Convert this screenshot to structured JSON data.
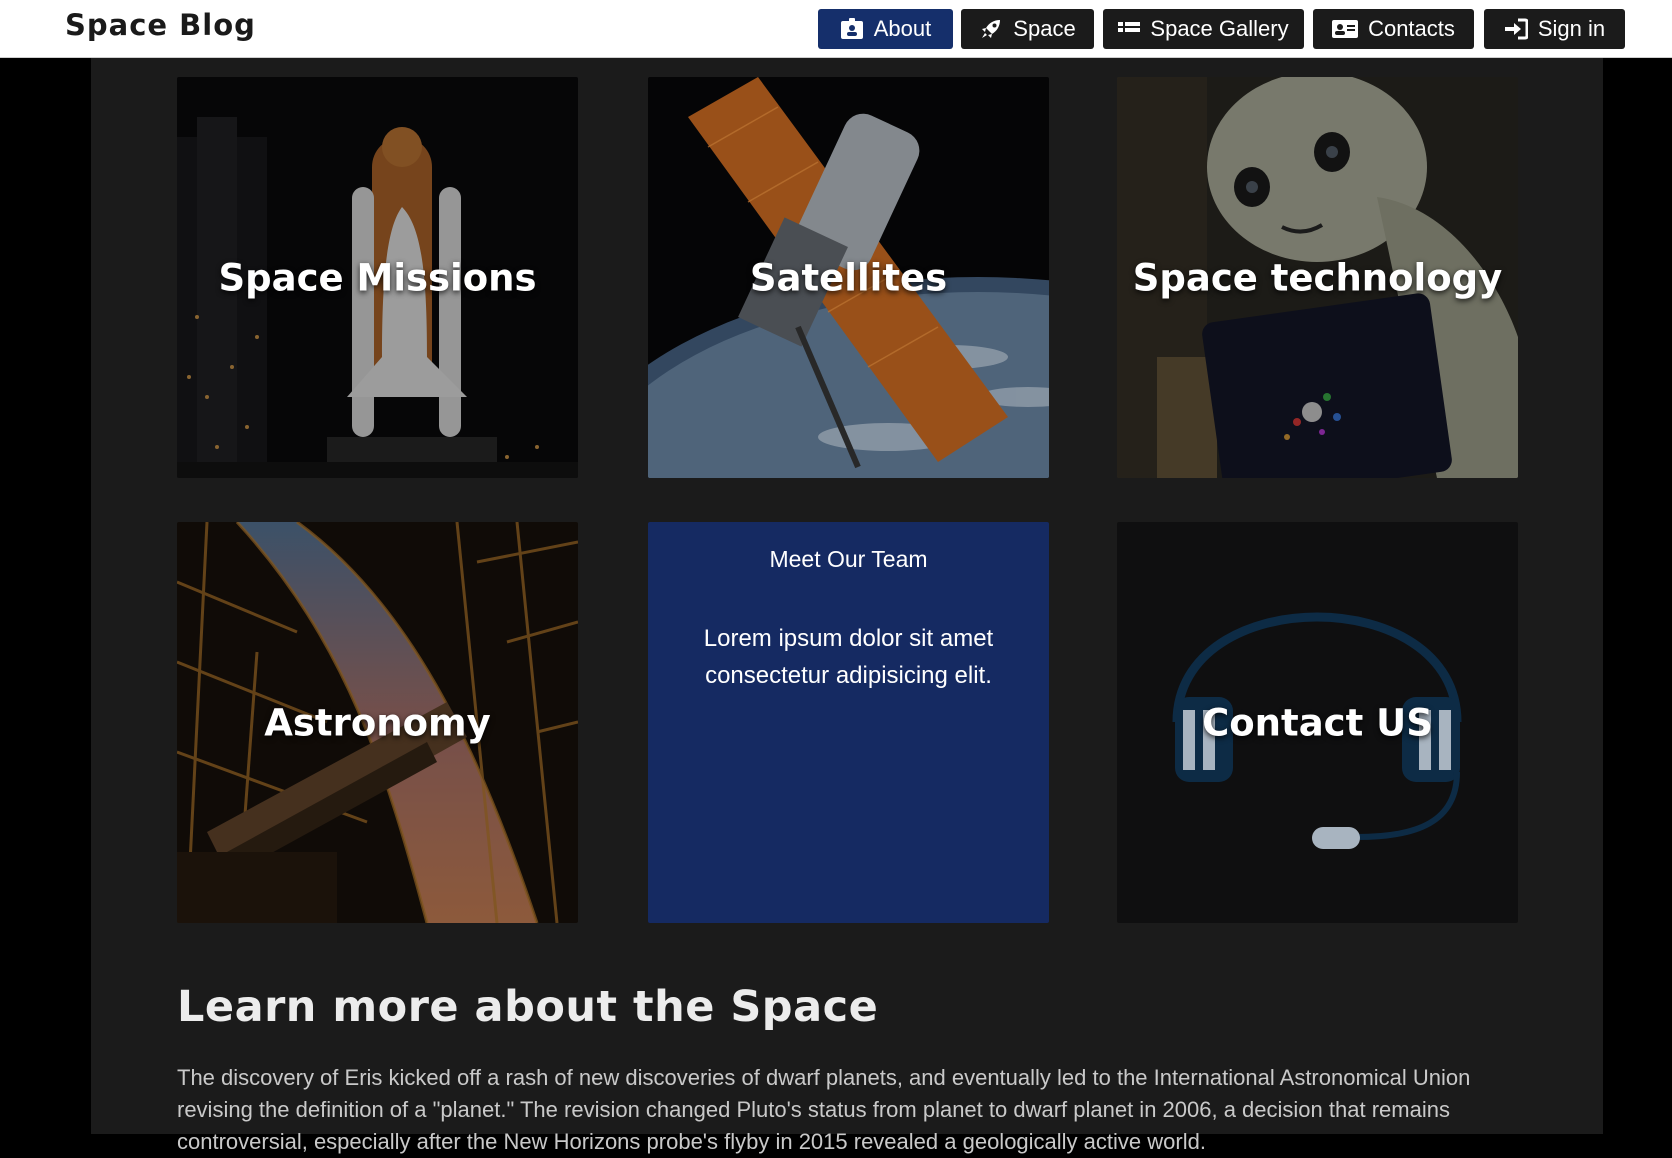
{
  "brand": "Space Blog",
  "nav": {
    "items": [
      {
        "label": "About",
        "icon": "id-badge-icon",
        "active": true
      },
      {
        "label": "Space",
        "icon": "rocket-icon",
        "active": false
      },
      {
        "label": "Space Gallery",
        "icon": "gallery-icon",
        "active": false
      },
      {
        "label": "Contacts",
        "icon": "address-card-icon",
        "active": false
      },
      {
        "label": "Sign in",
        "icon": "sign-in-icon",
        "active": false
      }
    ]
  },
  "cards": {
    "missions": "Space Missions",
    "satellites": "Satellites",
    "technology": "Space technology",
    "astronomy": "Astronomy",
    "team": {
      "heading": "Meet Our Team",
      "text": "Lorem ipsum dolor sit amet consectetur adipisicing elit."
    },
    "contact": "Contact US"
  },
  "section": {
    "title": "Learn more about the Space",
    "text": "The discovery of Eris kicked off a rash of new discoveries of dwarf planets, and eventually led to the International Astronomical Union revising the definition of a \"planet.\" The revision changed Pluto's status from planet to dwarf planet in 2006, a decision that remains controversial, especially after the New Horizons probe's flyby in 2015 revealed a geologically active world."
  },
  "colors": {
    "active_nav": "#152f6b",
    "nav_button": "#1b1b1b",
    "team_card": "#152a62",
    "content_bg": "#1b1b1b",
    "page_bg": "#000000"
  }
}
